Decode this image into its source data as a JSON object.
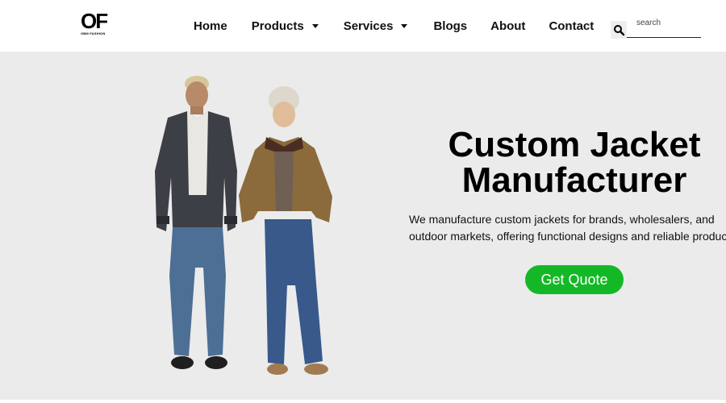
{
  "brand": {
    "logo_mark": "OF",
    "logo_sub": "OBM FASHION"
  },
  "nav": {
    "items": [
      {
        "label": "Home",
        "dropdown": false
      },
      {
        "label": "Products",
        "dropdown": true
      },
      {
        "label": "Services",
        "dropdown": true
      },
      {
        "label": "Blogs",
        "dropdown": false
      },
      {
        "label": "About",
        "dropdown": false
      },
      {
        "label": "Contact",
        "dropdown": false
      }
    ]
  },
  "search": {
    "placeholder": "search",
    "icon": "search-icon"
  },
  "hero": {
    "title_line1": "Custom Jacket",
    "title_line2": "Manufacturer",
    "desc_line1": "We manufacture custom jackets for brands, wholesalers, and",
    "desc_line2": "outdoor markets, offering functional designs and reliable production.",
    "cta_label": "Get Quote",
    "image": "two-models-wearing-jackets-photo"
  },
  "colors": {
    "hero_bg": "#ebebeb",
    "cta_bg": "#14b826",
    "header_bg": "#ffffff"
  }
}
